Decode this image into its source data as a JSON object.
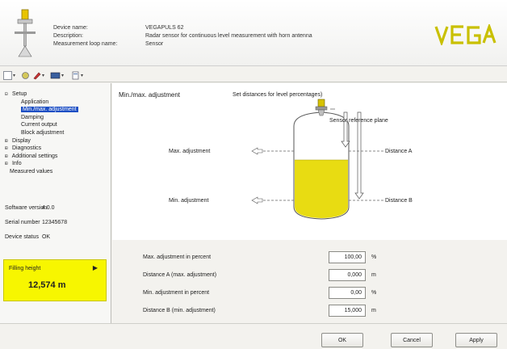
{
  "header": {
    "labels": {
      "device_name": "Device name:",
      "description": "Description:",
      "loop_name": "Measurement loop name:"
    },
    "values": {
      "device_name": "VEGAPULS 62",
      "description": "Radar sensor for continuous level measurement with horn antenna",
      "loop_name": "Sensor"
    },
    "logo": "VEGA"
  },
  "toolbar": {
    "icons": [
      "new-icon",
      "device-icon",
      "tools-icon",
      "display-icon",
      "document-icon"
    ]
  },
  "tree": {
    "setup": "Setup",
    "application": "Application",
    "minmax": "Min./max. adjustment",
    "damping": "Damping",
    "current_output": "Current output",
    "block": "Block adjustment",
    "display": "Display",
    "diagnostics": "Diagnostics",
    "additional": "Additional settings",
    "info": "Info",
    "measured": "Measured values"
  },
  "device_info": {
    "software_label": "Software version",
    "software_value": "4.0.0",
    "serial_label": "Serial number",
    "serial_value": "12345678",
    "status_label": "Device status",
    "status_value": "OK"
  },
  "filling": {
    "label": "Filling height",
    "value": "12,574 m"
  },
  "main": {
    "title": "Min./max. adjustment",
    "hint": "Set distances for level percentages)",
    "diagram": {
      "sensor_ref": "Sensor reference plane",
      "max_adj": "Max. adjustment",
      "min_adj": "Min. adjustment",
      "dist_a": "Distance A",
      "dist_b": "Distance B"
    }
  },
  "form": {
    "rows": [
      {
        "label": "Max. adjustment in percent",
        "value": "100,00",
        "unit": "%"
      },
      {
        "label": "Distance A (max. adjustment)",
        "value": "0,000",
        "unit": "m"
      },
      {
        "label": "Min. adjustment in percent",
        "value": "0,00",
        "unit": "%"
      },
      {
        "label": "Distance B (min. adjustment)",
        "value": "15,000",
        "unit": "m"
      }
    ]
  },
  "buttons": {
    "ok": "OK",
    "cancel": "Cancel",
    "apply": "Apply"
  },
  "colors": {
    "accent_yellow": "#f7f600",
    "liquid_yellow": "#e8dc12",
    "selection_blue": "#1d4fc4"
  }
}
